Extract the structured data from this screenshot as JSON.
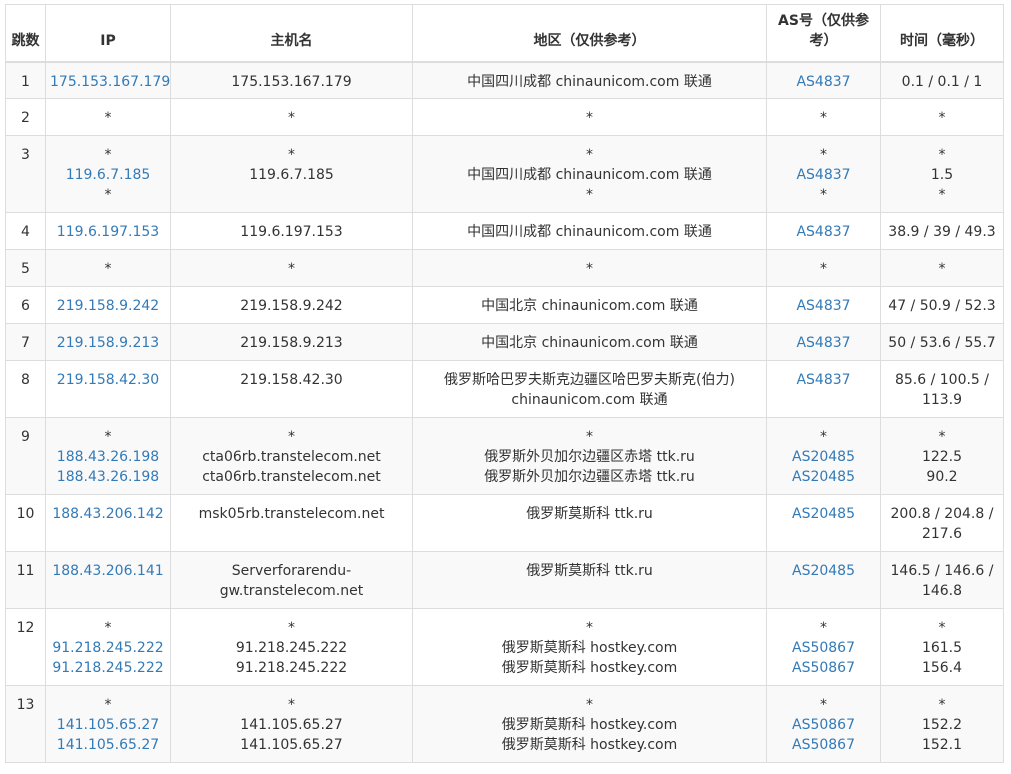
{
  "headers": {
    "hop": "跳数",
    "ip": "IP",
    "host": "主机名",
    "region": "地区（仅供参考）",
    "as": "AS号（仅供参考）",
    "time": "时间（毫秒）"
  },
  "colors": {
    "link": "#337ab7",
    "text": "#333333",
    "border": "#dddddd",
    "stripe": "#f9f9f9"
  },
  "rows": [
    {
      "hop": "1",
      "ip": [
        "175.153.167.179"
      ],
      "host": [
        "175.153.167.179"
      ],
      "region": [
        "中国四川成都 chinaunicom.com 联通"
      ],
      "as": [
        "AS4837"
      ],
      "time": [
        "0.1 / 0.1 / 1"
      ]
    },
    {
      "hop": "2",
      "ip": [
        "*"
      ],
      "host": [
        "*"
      ],
      "region": [
        "*"
      ],
      "as": [
        "*"
      ],
      "time": [
        "*"
      ]
    },
    {
      "hop": "3",
      "ip": [
        "*",
        "119.6.7.185",
        "*"
      ],
      "host": [
        "*",
        "119.6.7.185",
        ""
      ],
      "region": [
        "*",
        "中国四川成都 chinaunicom.com 联通",
        "*"
      ],
      "as": [
        "*",
        "AS4837",
        "*"
      ],
      "time": [
        "*",
        "1.5",
        "*"
      ]
    },
    {
      "hop": "4",
      "ip": [
        "119.6.197.153"
      ],
      "host": [
        "119.6.197.153"
      ],
      "region": [
        "中国四川成都 chinaunicom.com 联通"
      ],
      "as": [
        "AS4837"
      ],
      "time": [
        "38.9 / 39 / 49.3"
      ]
    },
    {
      "hop": "5",
      "ip": [
        "*"
      ],
      "host": [
        "*"
      ],
      "region": [
        "*"
      ],
      "as": [
        "*"
      ],
      "time": [
        "*"
      ]
    },
    {
      "hop": "6",
      "ip": [
        "219.158.9.242"
      ],
      "host": [
        "219.158.9.242"
      ],
      "region": [
        "中国北京 chinaunicom.com 联通"
      ],
      "as": [
        "AS4837"
      ],
      "time": [
        "47 / 50.9 / 52.3"
      ]
    },
    {
      "hop": "7",
      "ip": [
        "219.158.9.213"
      ],
      "host": [
        "219.158.9.213"
      ],
      "region": [
        "中国北京 chinaunicom.com 联通"
      ],
      "as": [
        "AS4837"
      ],
      "time": [
        "50 / 53.6 / 55.7"
      ]
    },
    {
      "hop": "8",
      "ip": [
        "219.158.42.30"
      ],
      "host": [
        "219.158.42.30"
      ],
      "region": [
        "俄罗斯哈巴罗夫斯克边疆区哈巴罗夫斯克(伯力) chinaunicom.com 联通"
      ],
      "as": [
        "AS4837"
      ],
      "time": [
        "85.6 / 100.5 / 113.9"
      ]
    },
    {
      "hop": "9",
      "ip": [
        "*",
        "188.43.26.198",
        "188.43.26.198"
      ],
      "host": [
        "*",
        "cta06rb.transtelecom.net",
        "cta06rb.transtelecom.net"
      ],
      "region": [
        "*",
        "俄罗斯外贝加尔边疆区赤塔 ttk.ru",
        "俄罗斯外贝加尔边疆区赤塔 ttk.ru"
      ],
      "as": [
        "*",
        "AS20485",
        "AS20485"
      ],
      "time": [
        "*",
        "122.5",
        "90.2"
      ]
    },
    {
      "hop": "10",
      "ip": [
        "188.43.206.142"
      ],
      "host": [
        "msk05rb.transtelecom.net"
      ],
      "region": [
        "俄罗斯莫斯科 ttk.ru"
      ],
      "as": [
        "AS20485"
      ],
      "time": [
        "200.8 / 204.8 / 217.6"
      ]
    },
    {
      "hop": "11",
      "ip": [
        "188.43.206.141"
      ],
      "host": [
        "Serverforarendu-gw.transtelecom.net"
      ],
      "region": [
        "俄罗斯莫斯科 ttk.ru"
      ],
      "as": [
        "AS20485"
      ],
      "time": [
        "146.5 / 146.6 / 146.8"
      ]
    },
    {
      "hop": "12",
      "ip": [
        "*",
        "91.218.245.222",
        "91.218.245.222"
      ],
      "host": [
        "*",
        "91.218.245.222",
        "91.218.245.222"
      ],
      "region": [
        "*",
        "俄罗斯莫斯科 hostkey.com",
        "俄罗斯莫斯科 hostkey.com"
      ],
      "as": [
        "*",
        "AS50867",
        "AS50867"
      ],
      "time": [
        "*",
        "161.5",
        "156.4"
      ]
    },
    {
      "hop": "13",
      "ip": [
        "*",
        "141.105.65.27",
        "141.105.65.27"
      ],
      "host": [
        "*",
        "141.105.65.27",
        "141.105.65.27"
      ],
      "region": [
        "*",
        "俄罗斯莫斯科 hostkey.com",
        "俄罗斯莫斯科 hostkey.com"
      ],
      "as": [
        "*",
        "AS50867",
        "AS50867"
      ],
      "time": [
        "*",
        "152.2",
        "152.1"
      ]
    }
  ]
}
